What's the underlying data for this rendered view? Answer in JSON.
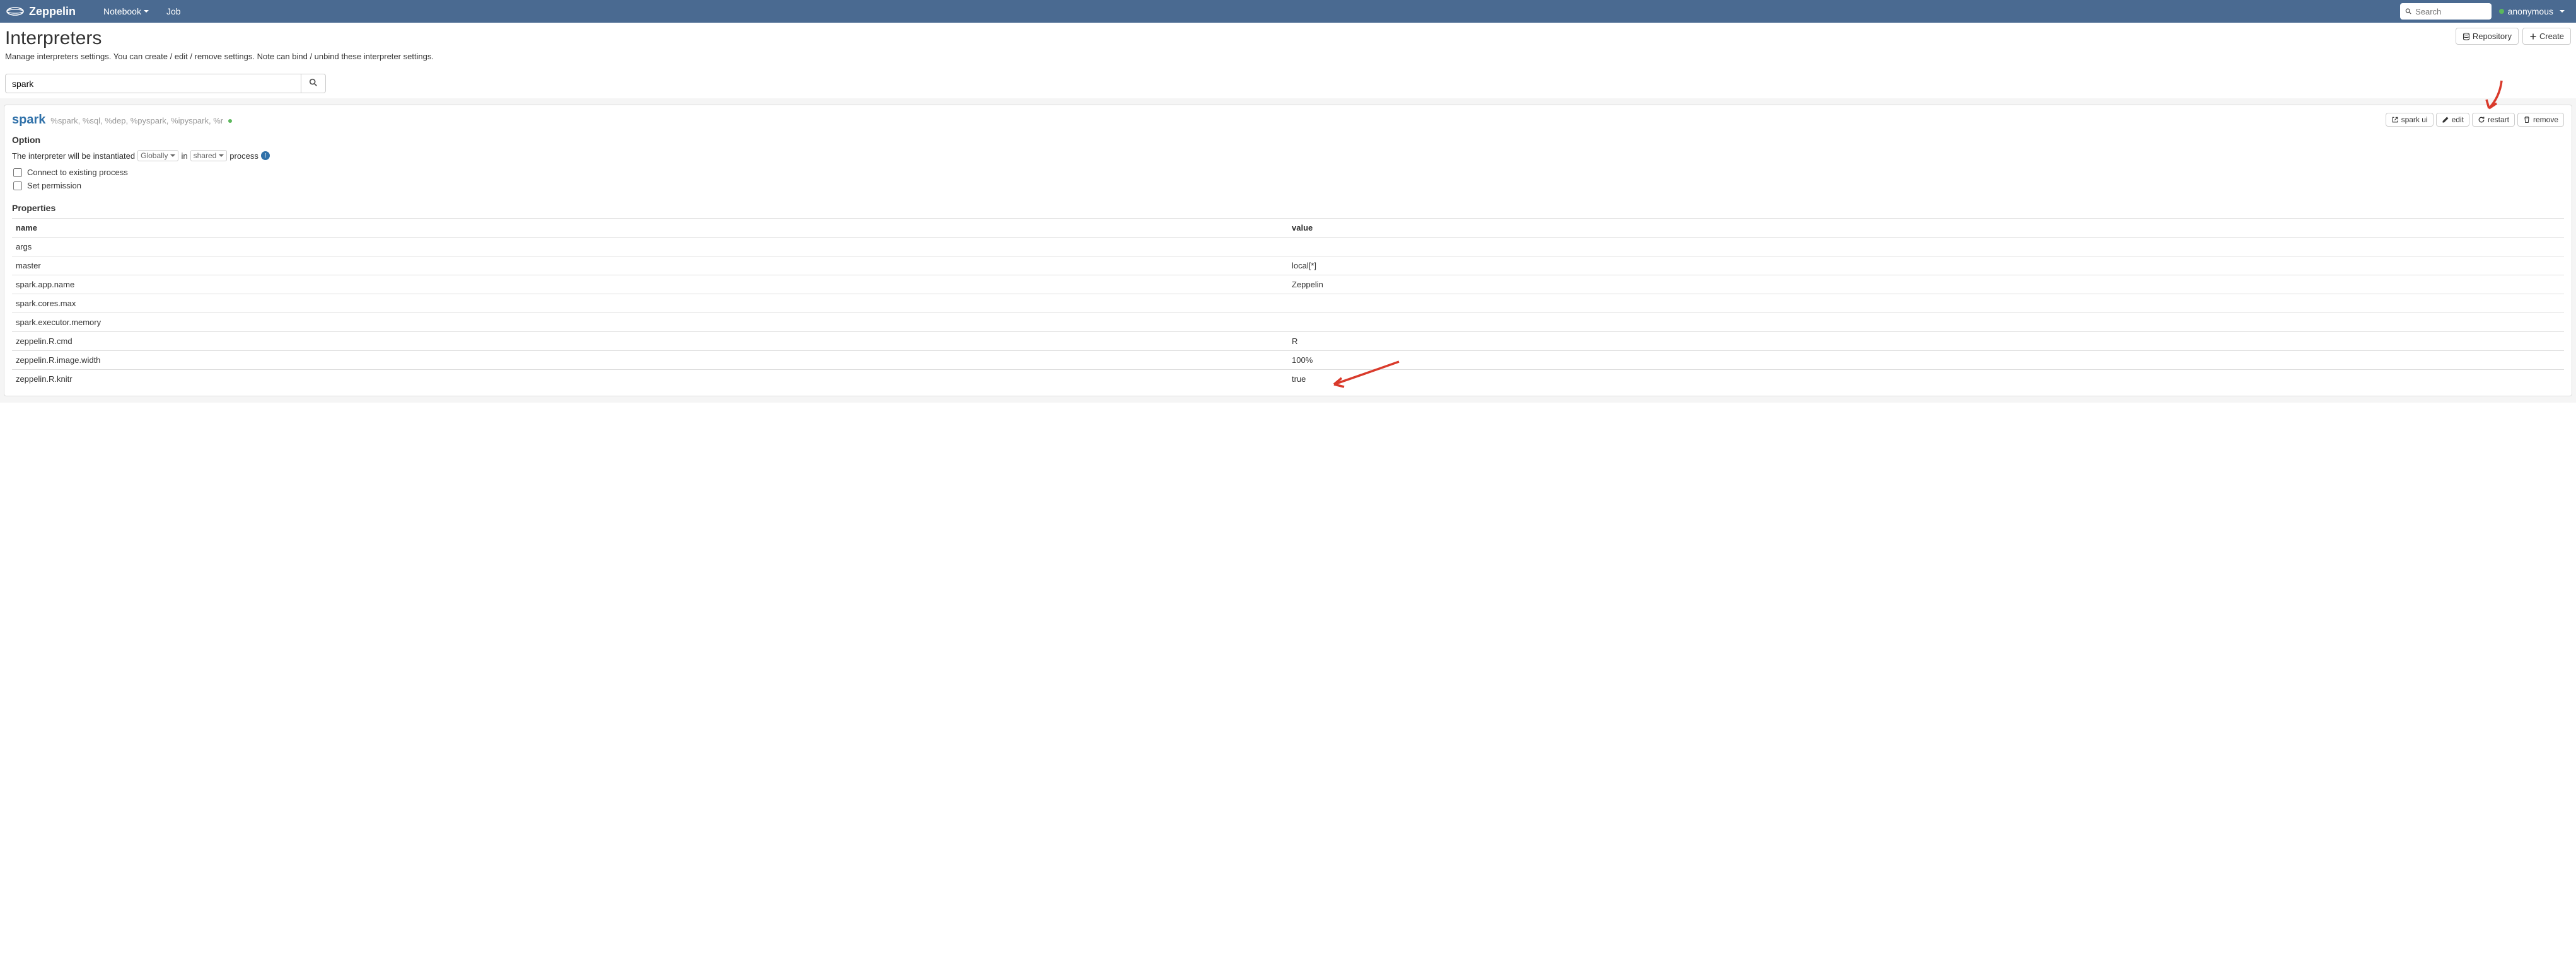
{
  "navbar": {
    "brand": "Zeppelin",
    "menu": {
      "notebook": "Notebook",
      "job": "Job"
    },
    "search_placeholder": "Search",
    "user": "anonymous"
  },
  "page": {
    "title": "Interpreters",
    "description": "Manage interpreters settings. You can create / edit / remove settings. Note can bind / unbind these interpreter settings.",
    "repository_btn": "Repository",
    "create_btn": "Create",
    "filter_value": "spark"
  },
  "interpreter": {
    "name": "spark",
    "aliases": "%spark, %sql, %dep, %pyspark, %ipyspark, %r",
    "buttons": {
      "spark_ui": "spark ui",
      "edit": "edit",
      "restart": "restart",
      "remove": "remove"
    },
    "option_title": "Option",
    "instantiated_prefix": "The interpreter will be instantiated",
    "instantiated_scope": "Globally",
    "instantiated_in": "in",
    "instantiated_mode": "shared",
    "instantiated_suffix": "process",
    "connect_existing": "Connect to existing process",
    "set_permission": "Set permission",
    "properties_title": "Properties",
    "table": {
      "headers": {
        "name": "name",
        "value": "value"
      },
      "rows": [
        {
          "name": "args",
          "value": ""
        },
        {
          "name": "master",
          "value": "local[*]"
        },
        {
          "name": "spark.app.name",
          "value": "Zeppelin"
        },
        {
          "name": "spark.cores.max",
          "value": ""
        },
        {
          "name": "spark.executor.memory",
          "value": ""
        },
        {
          "name": "zeppelin.R.cmd",
          "value": "R"
        },
        {
          "name": "zeppelin.R.image.width",
          "value": "100%"
        },
        {
          "name": "zeppelin.R.knitr",
          "value": "true"
        }
      ]
    }
  }
}
